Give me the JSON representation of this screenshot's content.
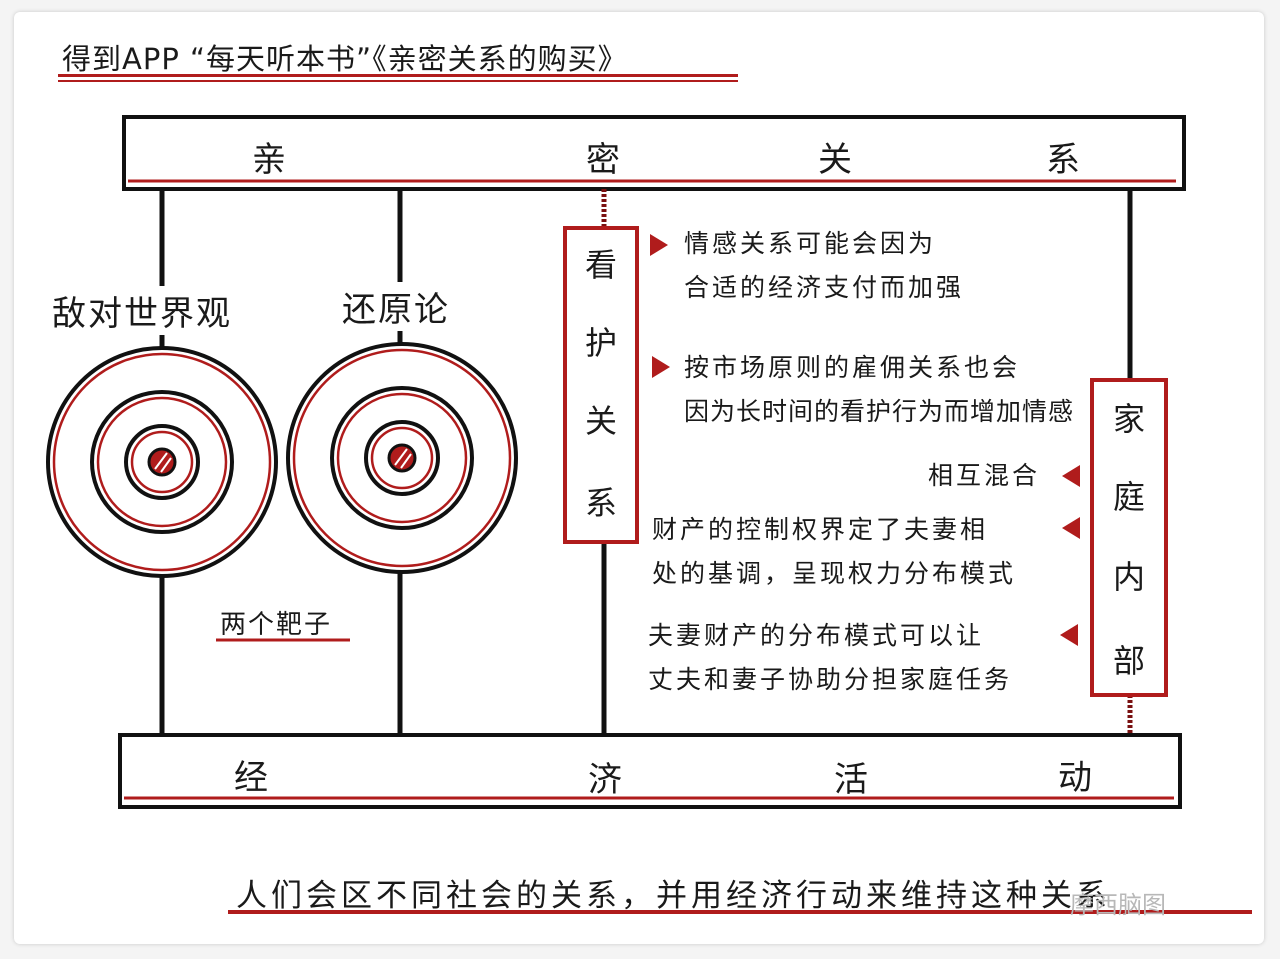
{
  "title": "得到APP “每天听本书”《亲密关系的购买》",
  "top_bar": {
    "chars": [
      "亲",
      "密",
      "关",
      "系"
    ]
  },
  "bottom_bar": {
    "chars": [
      "经",
      "济",
      "活",
      "动"
    ]
  },
  "left_concepts": {
    "hostile_worlds": "敌对世界观",
    "reductionism": "还原论",
    "targets_label": "两个靶子"
  },
  "care_box": {
    "chars": [
      "看",
      "护",
      "关",
      "系"
    ]
  },
  "family_box": {
    "chars": [
      "家",
      "庭",
      "内",
      "部"
    ]
  },
  "right_notes": [
    {
      "line1": "情感关系可能会因为",
      "line2": "合适的经济支付而加强"
    },
    {
      "line1": "按市场原则的雇佣关系也会",
      "line2": "因为长时间的看护行为而增加情感"
    }
  ],
  "left_notes": [
    {
      "line1": "相互混合"
    },
    {
      "line1": "财产的控制权界定了夫妻相",
      "line2": "处的基调，呈现权力分布模式"
    },
    {
      "line1": "夫妻财产的分布模式可以让",
      "line2": "丈夫和妻子协助分担家庭任务"
    }
  ],
  "footer": "人们会区不同社会的关系，并用经济行动来维持这种关系",
  "watermark": "摩西脑图",
  "colors": {
    "accent": "#b01c1c",
    "ink": "#111111"
  }
}
